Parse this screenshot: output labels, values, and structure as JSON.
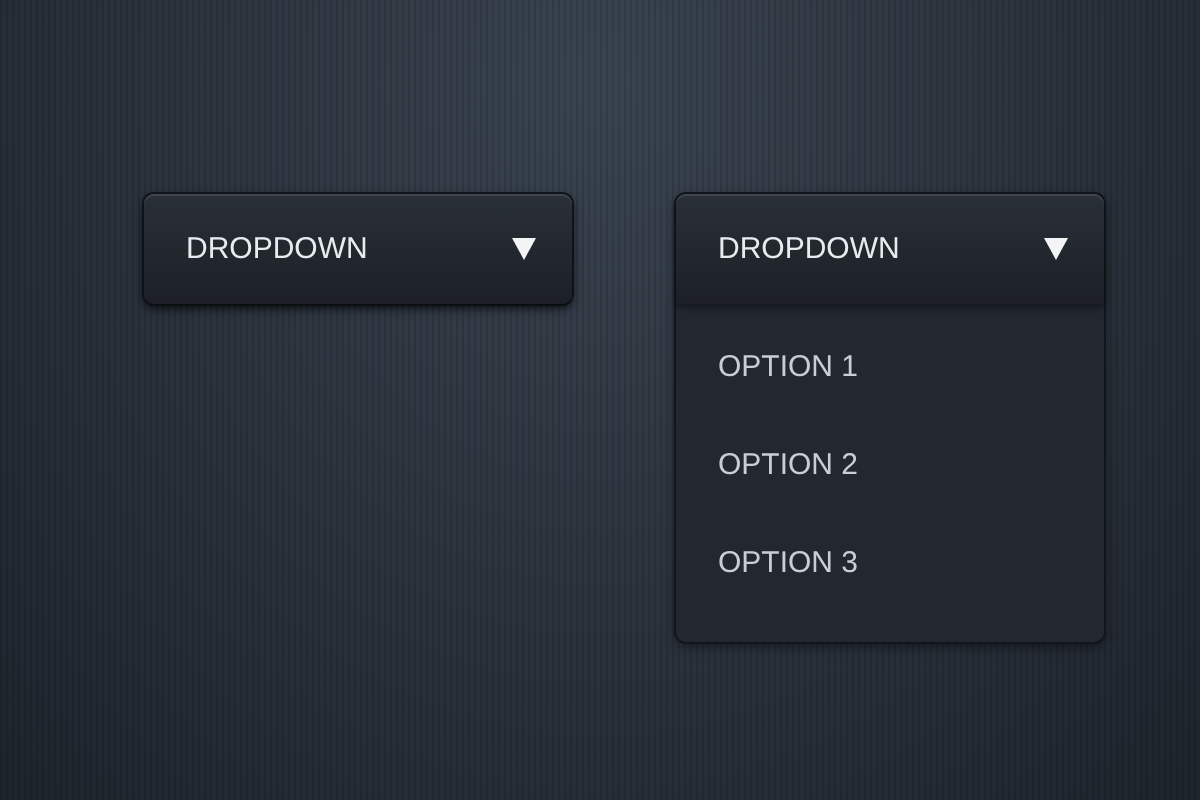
{
  "dropdowns": [
    {
      "label": "DROPDOWN",
      "expanded": false
    },
    {
      "label": "DROPDOWN",
      "expanded": true,
      "options": [
        {
          "label": "OPTION 1"
        },
        {
          "label": "OPTION 2"
        },
        {
          "label": "OPTION 3"
        }
      ]
    }
  ]
}
